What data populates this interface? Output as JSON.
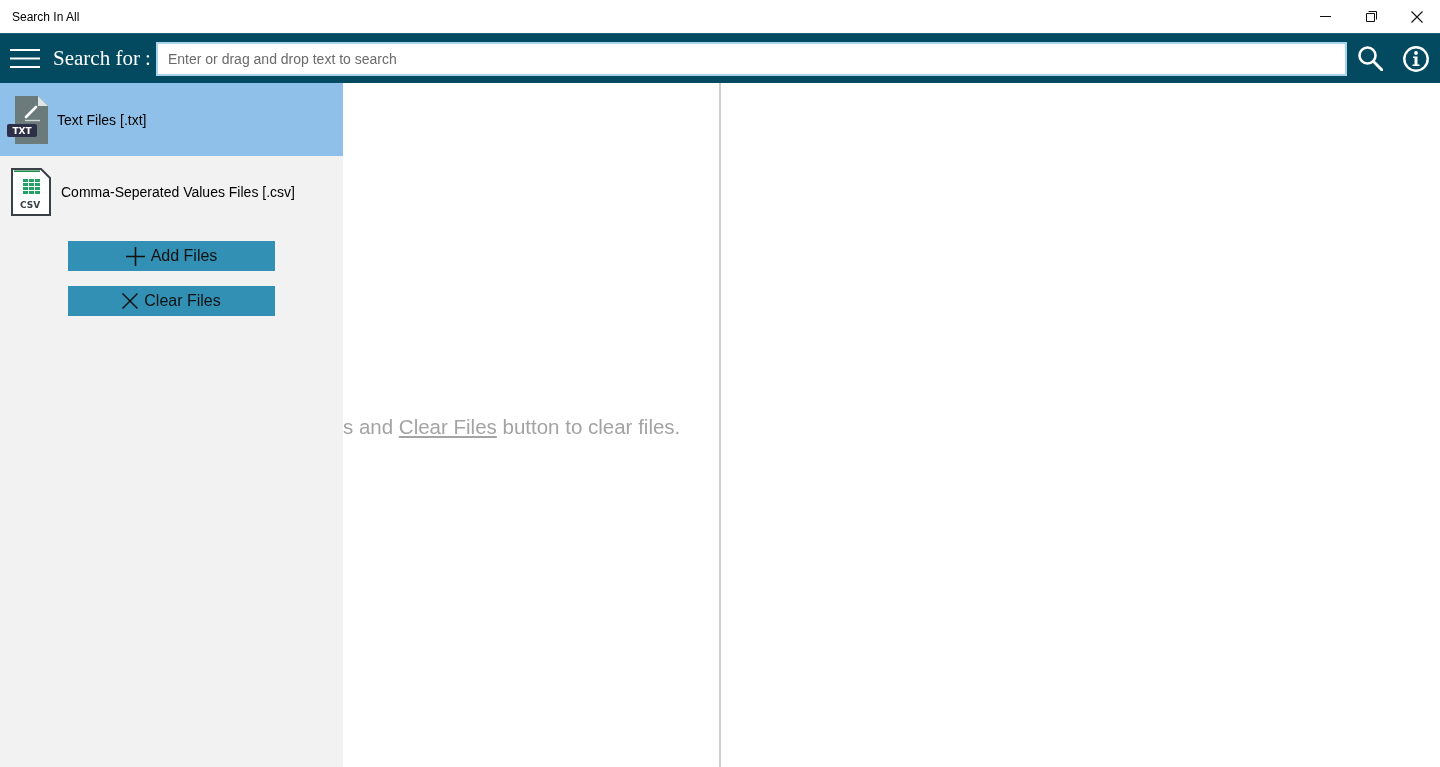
{
  "window": {
    "title": "Search In All"
  },
  "toolbar": {
    "label": "Search for :",
    "search": {
      "placeholder": "Enter or drag and drop text to search"
    }
  },
  "sidebar": {
    "items": [
      {
        "label": "Text Files [.txt]",
        "kind": "txt",
        "badge": "TXT",
        "selected": true
      },
      {
        "label": "Comma-Seperated Values Files [.csv]",
        "kind": "csv",
        "badge": "CSV",
        "selected": false
      }
    ],
    "buttons": [
      {
        "label": "Add Files",
        "kind": "add"
      },
      {
        "label": "Clear Files",
        "kind": "clear"
      }
    ]
  },
  "hint": {
    "before": "s and ",
    "link": "Clear Files",
    "after": " button to clear files."
  }
}
